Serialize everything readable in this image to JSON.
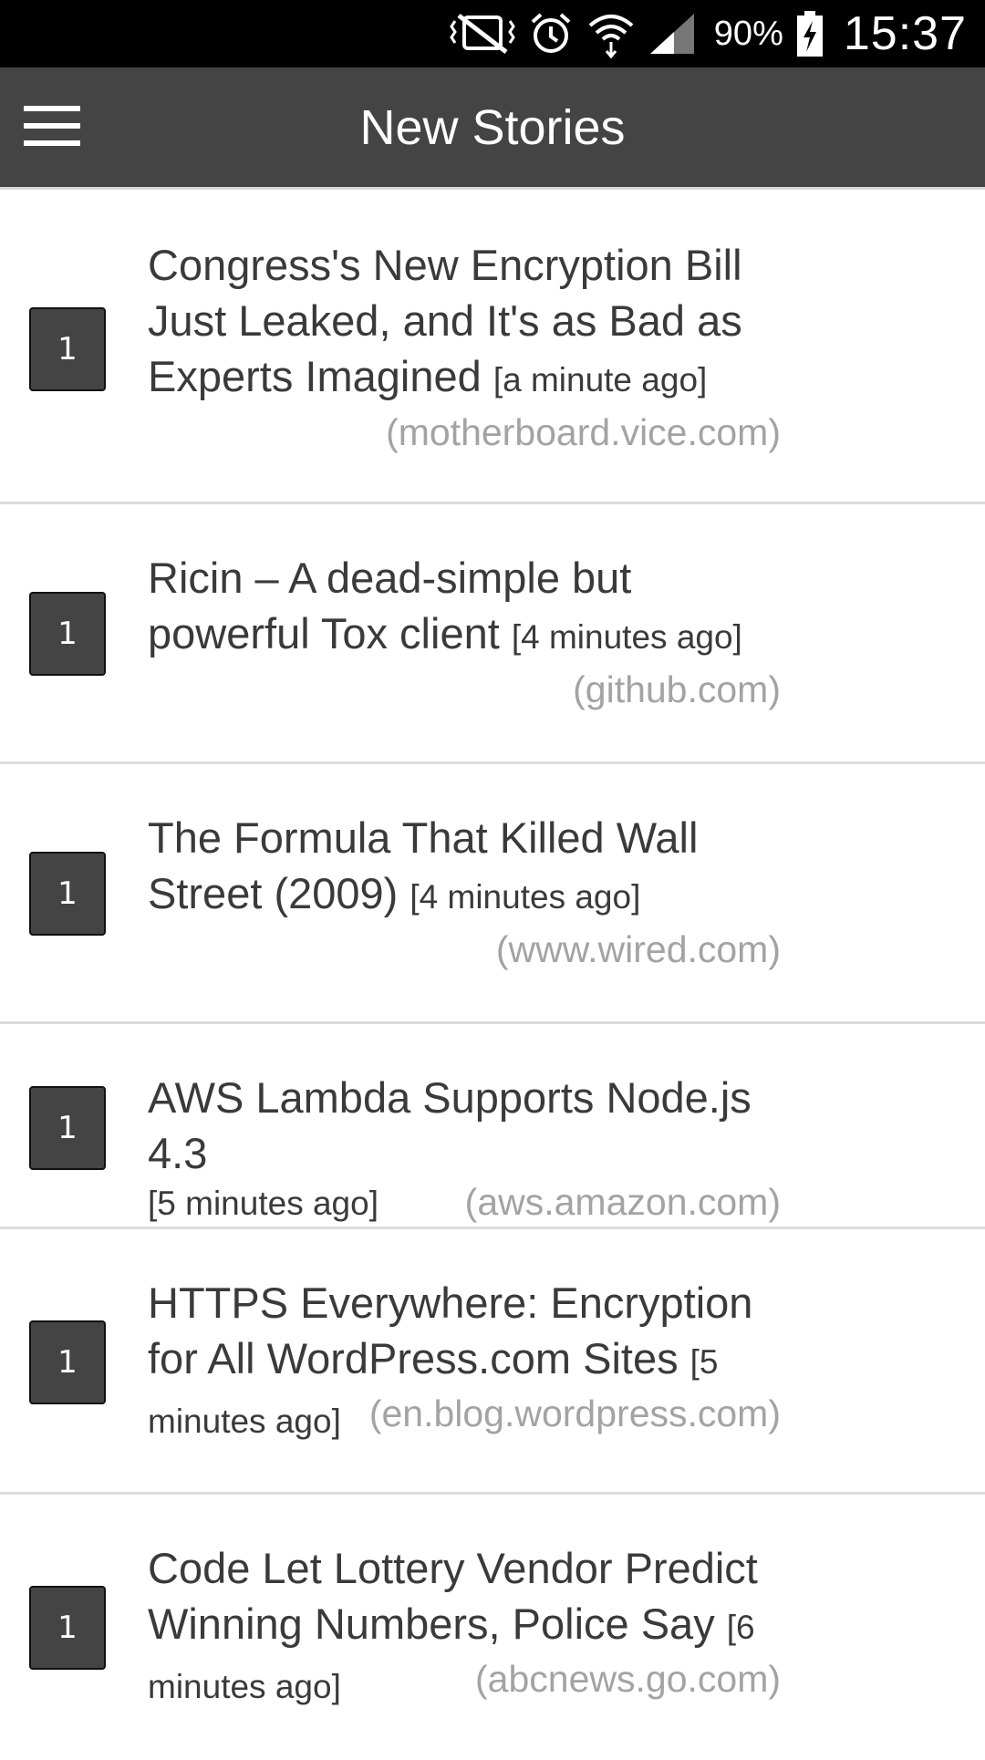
{
  "status": {
    "battery": "90%",
    "time": "15:37"
  },
  "appbar": {
    "title": "New Stories"
  },
  "stories": [
    {
      "score": "1",
      "title": "Congress's New Encryption Bill Just Leaked, and It's as Bad as Experts Imagined",
      "time": "[a minute ago]",
      "domain": "(motherboard.vice.com)"
    },
    {
      "score": "1",
      "title": "Ricin – A dead-simple but powerful Tox client",
      "time": "[4 minutes ago]",
      "domain": "(github.com)"
    },
    {
      "score": "1",
      "title": "The Formula That Killed Wall Street (2009)",
      "time": "[4 minutes ago]",
      "domain": "(www.wired.com)"
    },
    {
      "score": "1",
      "title": "AWS Lambda Supports Node.js 4.3",
      "time": "[5 minutes ago]",
      "domain": "(aws.amazon.com)"
    },
    {
      "score": "1",
      "title": "HTTPS Everywhere: Encryption for All WordPress.com Sites",
      "time": "[5 minutes ago]",
      "domain": "(en.blog.wordpress.com)"
    },
    {
      "score": "1",
      "title": "Code Let Lottery Vendor Predict Winning Numbers, Police Say",
      "time": "[6 minutes ago]",
      "domain": "(abcnews.go.com)"
    }
  ]
}
